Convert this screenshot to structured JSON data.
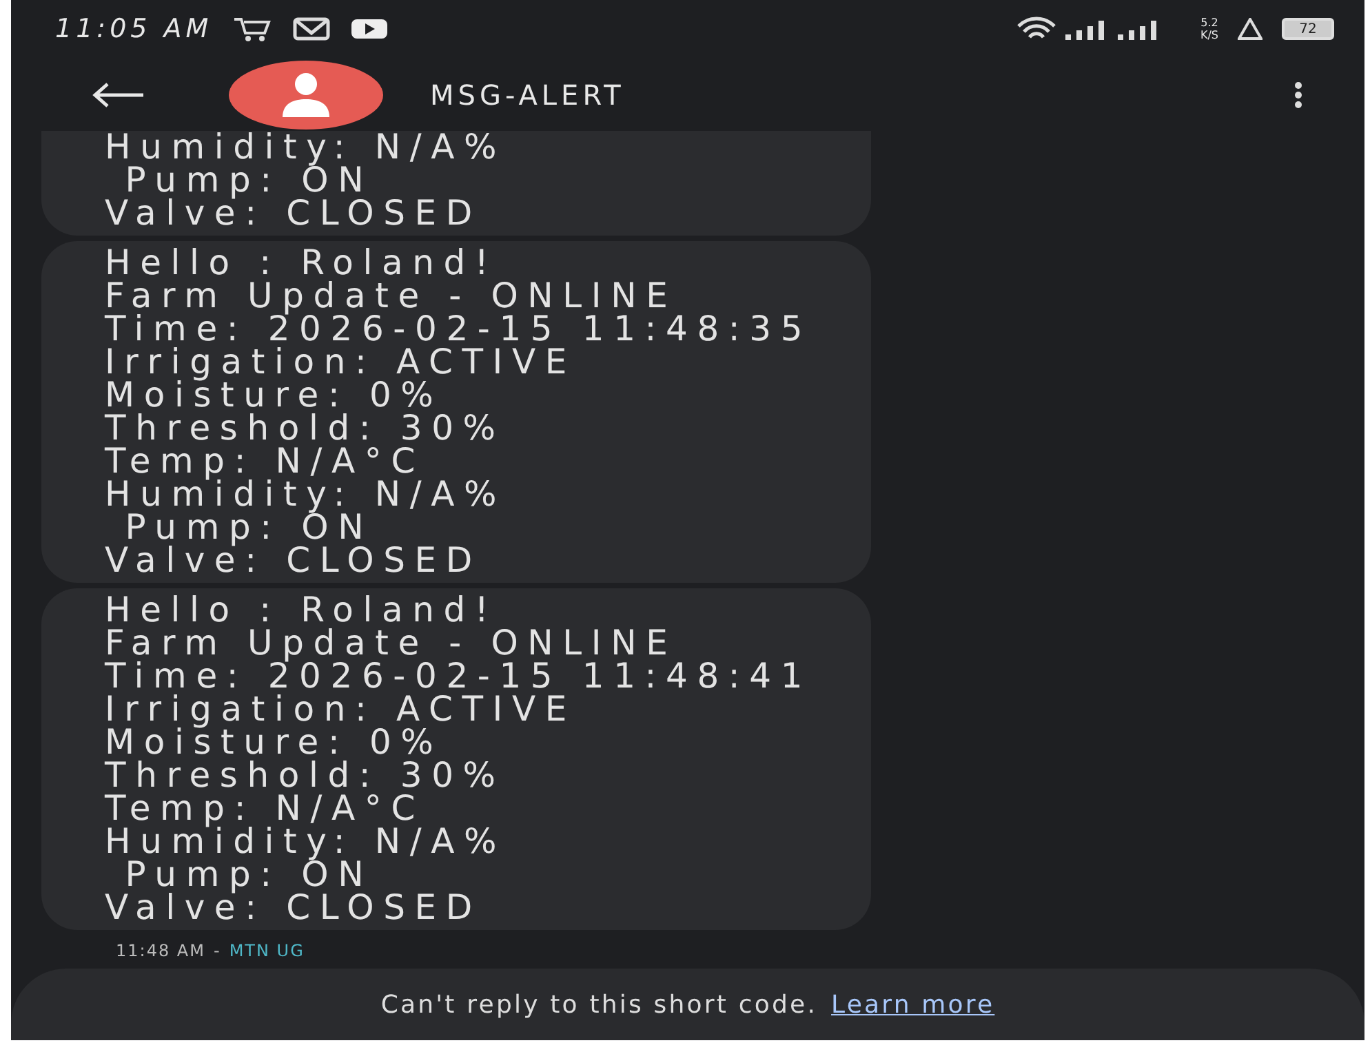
{
  "status_bar": {
    "time": "11:05 AM",
    "network_speed": "5.2",
    "network_unit": "K/S",
    "battery": "72"
  },
  "header": {
    "title": "MSG-ALERT"
  },
  "messages": [
    {
      "partial": true,
      "lines": [
        "Humidity: N/A%",
        " Pump: ON",
        "Valve: CLOSED"
      ]
    },
    {
      "partial": false,
      "lines": [
        "Hello : Roland!",
        "Farm Update - ONLINE",
        "Time: 2026-02-15 11:48:35",
        "Irrigation: ACTIVE",
        "Moisture: 0%",
        "Threshold: 30%",
        "Temp: N/A°C",
        "Humidity: N/A%",
        " Pump: ON",
        "Valve: CLOSED"
      ]
    },
    {
      "partial": false,
      "lines": [
        "Hello : Roland!",
        "Farm Update - ONLINE",
        "Time: 2026-02-15 11:48:41",
        "Irrigation: ACTIVE",
        "Moisture: 0%",
        "Threshold: 30%",
        "Temp: N/A°C",
        "Humidity: N/A%",
        " Pump: ON",
        "Valve: CLOSED"
      ]
    }
  ],
  "message_meta": {
    "time": "11:48 AM",
    "separator": "-",
    "carrier": "MTN UG"
  },
  "footer": {
    "notice": "Can't reply to this short code.",
    "link": "Learn more"
  }
}
